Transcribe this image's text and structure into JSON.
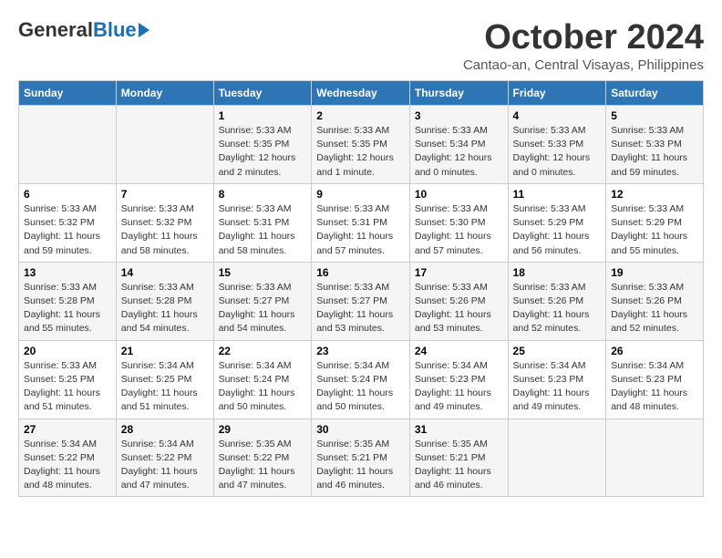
{
  "header": {
    "logo_general": "General",
    "logo_blue": "Blue",
    "month_title": "October 2024",
    "location": "Cantao-an, Central Visayas, Philippines"
  },
  "columns": [
    "Sunday",
    "Monday",
    "Tuesday",
    "Wednesday",
    "Thursday",
    "Friday",
    "Saturday"
  ],
  "weeks": [
    [
      {
        "num": "",
        "detail": ""
      },
      {
        "num": "",
        "detail": ""
      },
      {
        "num": "1",
        "detail": "Sunrise: 5:33 AM\nSunset: 5:35 PM\nDaylight: 12 hours\nand 2 minutes."
      },
      {
        "num": "2",
        "detail": "Sunrise: 5:33 AM\nSunset: 5:35 PM\nDaylight: 12 hours\nand 1 minute."
      },
      {
        "num": "3",
        "detail": "Sunrise: 5:33 AM\nSunset: 5:34 PM\nDaylight: 12 hours\nand 0 minutes."
      },
      {
        "num": "4",
        "detail": "Sunrise: 5:33 AM\nSunset: 5:33 PM\nDaylight: 12 hours\nand 0 minutes."
      },
      {
        "num": "5",
        "detail": "Sunrise: 5:33 AM\nSunset: 5:33 PM\nDaylight: 11 hours\nand 59 minutes."
      }
    ],
    [
      {
        "num": "6",
        "detail": "Sunrise: 5:33 AM\nSunset: 5:32 PM\nDaylight: 11 hours\nand 59 minutes."
      },
      {
        "num": "7",
        "detail": "Sunrise: 5:33 AM\nSunset: 5:32 PM\nDaylight: 11 hours\nand 58 minutes."
      },
      {
        "num": "8",
        "detail": "Sunrise: 5:33 AM\nSunset: 5:31 PM\nDaylight: 11 hours\nand 58 minutes."
      },
      {
        "num": "9",
        "detail": "Sunrise: 5:33 AM\nSunset: 5:31 PM\nDaylight: 11 hours\nand 57 minutes."
      },
      {
        "num": "10",
        "detail": "Sunrise: 5:33 AM\nSunset: 5:30 PM\nDaylight: 11 hours\nand 57 minutes."
      },
      {
        "num": "11",
        "detail": "Sunrise: 5:33 AM\nSunset: 5:29 PM\nDaylight: 11 hours\nand 56 minutes."
      },
      {
        "num": "12",
        "detail": "Sunrise: 5:33 AM\nSunset: 5:29 PM\nDaylight: 11 hours\nand 55 minutes."
      }
    ],
    [
      {
        "num": "13",
        "detail": "Sunrise: 5:33 AM\nSunset: 5:28 PM\nDaylight: 11 hours\nand 55 minutes."
      },
      {
        "num": "14",
        "detail": "Sunrise: 5:33 AM\nSunset: 5:28 PM\nDaylight: 11 hours\nand 54 minutes."
      },
      {
        "num": "15",
        "detail": "Sunrise: 5:33 AM\nSunset: 5:27 PM\nDaylight: 11 hours\nand 54 minutes."
      },
      {
        "num": "16",
        "detail": "Sunrise: 5:33 AM\nSunset: 5:27 PM\nDaylight: 11 hours\nand 53 minutes."
      },
      {
        "num": "17",
        "detail": "Sunrise: 5:33 AM\nSunset: 5:26 PM\nDaylight: 11 hours\nand 53 minutes."
      },
      {
        "num": "18",
        "detail": "Sunrise: 5:33 AM\nSunset: 5:26 PM\nDaylight: 11 hours\nand 52 minutes."
      },
      {
        "num": "19",
        "detail": "Sunrise: 5:33 AM\nSunset: 5:26 PM\nDaylight: 11 hours\nand 52 minutes."
      }
    ],
    [
      {
        "num": "20",
        "detail": "Sunrise: 5:33 AM\nSunset: 5:25 PM\nDaylight: 11 hours\nand 51 minutes."
      },
      {
        "num": "21",
        "detail": "Sunrise: 5:34 AM\nSunset: 5:25 PM\nDaylight: 11 hours\nand 51 minutes."
      },
      {
        "num": "22",
        "detail": "Sunrise: 5:34 AM\nSunset: 5:24 PM\nDaylight: 11 hours\nand 50 minutes."
      },
      {
        "num": "23",
        "detail": "Sunrise: 5:34 AM\nSunset: 5:24 PM\nDaylight: 11 hours\nand 50 minutes."
      },
      {
        "num": "24",
        "detail": "Sunrise: 5:34 AM\nSunset: 5:23 PM\nDaylight: 11 hours\nand 49 minutes."
      },
      {
        "num": "25",
        "detail": "Sunrise: 5:34 AM\nSunset: 5:23 PM\nDaylight: 11 hours\nand 49 minutes."
      },
      {
        "num": "26",
        "detail": "Sunrise: 5:34 AM\nSunset: 5:23 PM\nDaylight: 11 hours\nand 48 minutes."
      }
    ],
    [
      {
        "num": "27",
        "detail": "Sunrise: 5:34 AM\nSunset: 5:22 PM\nDaylight: 11 hours\nand 48 minutes."
      },
      {
        "num": "28",
        "detail": "Sunrise: 5:34 AM\nSunset: 5:22 PM\nDaylight: 11 hours\nand 47 minutes."
      },
      {
        "num": "29",
        "detail": "Sunrise: 5:35 AM\nSunset: 5:22 PM\nDaylight: 11 hours\nand 47 minutes."
      },
      {
        "num": "30",
        "detail": "Sunrise: 5:35 AM\nSunset: 5:21 PM\nDaylight: 11 hours\nand 46 minutes."
      },
      {
        "num": "31",
        "detail": "Sunrise: 5:35 AM\nSunset: 5:21 PM\nDaylight: 11 hours\nand 46 minutes."
      },
      {
        "num": "",
        "detail": ""
      },
      {
        "num": "",
        "detail": ""
      }
    ]
  ]
}
